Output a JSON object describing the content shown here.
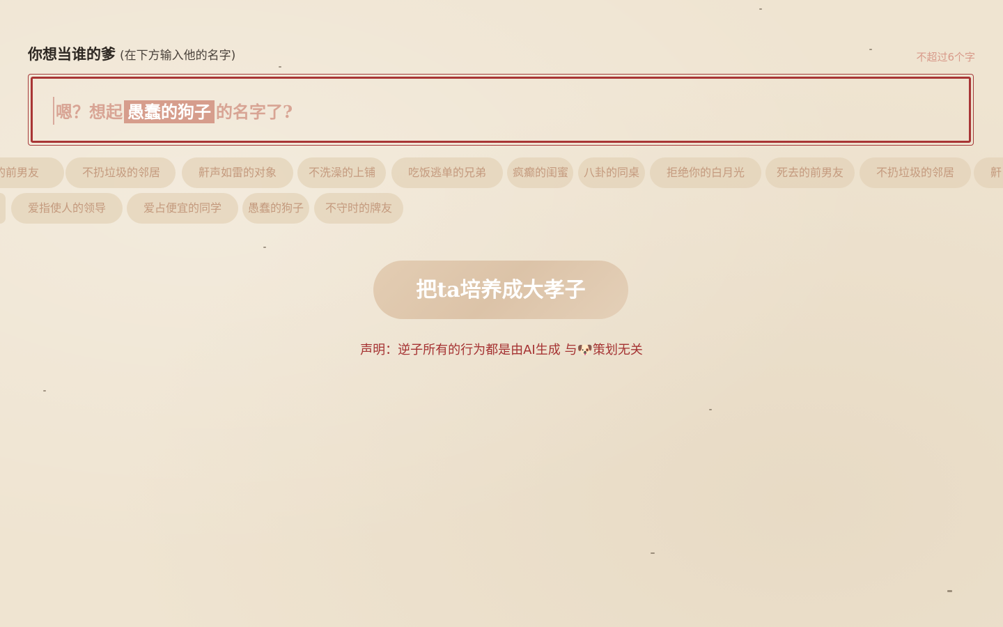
{
  "header": {
    "title": "你想当谁的爹",
    "subtitle": "(在下方输入他的名字)",
    "limit_hint": "不超过6个字"
  },
  "name_input": {
    "placeholder_prefix": "嗯？想起",
    "placeholder_highlight": "愚蠢的狗子",
    "placeholder_suffix": "的名字了?"
  },
  "suggestions": {
    "row1": [
      "去的前男友",
      "不扔垃圾的邻居",
      "鼾声如雷的对象",
      "不洗澡的上铺",
      "吃饭逃单的兄弟",
      "疯癫的闺蜜",
      "八卦的同桌",
      "拒绝你的白月光",
      "死去的前男友",
      "不扔垃圾的邻居",
      "鼾"
    ],
    "row2": [
      "",
      "爱指使人的领导",
      "爱占便宜的同学",
      "愚蠢的狗子",
      "不守时的牌友"
    ]
  },
  "cta": {
    "label": "把ta培养成大孝子"
  },
  "disclaimer": {
    "text": "声明：逆子所有的行为都是由AI生成 与🐶策划无关"
  }
}
